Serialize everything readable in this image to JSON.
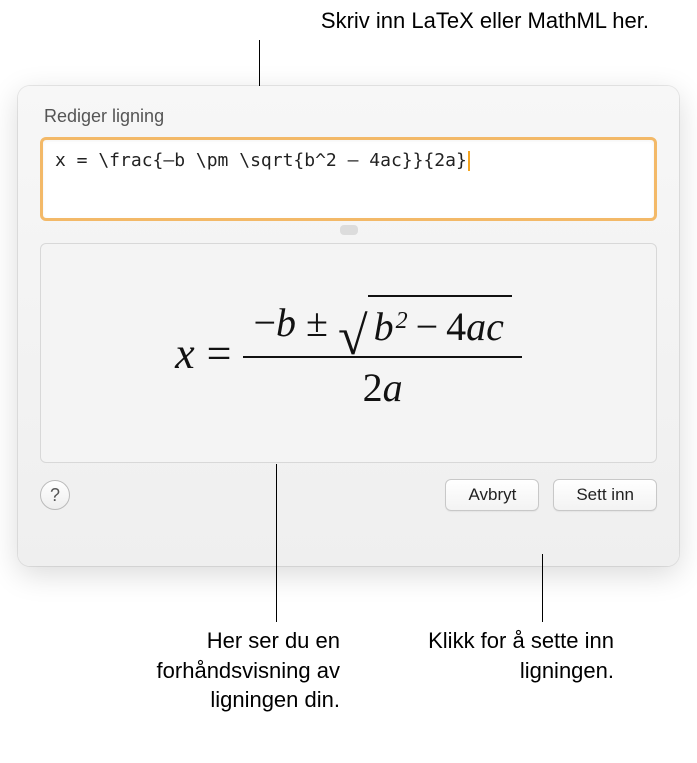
{
  "callouts": {
    "top": "Skriv inn LaTeX eller MathML her.",
    "preview": "Her ser du en forhåndsvisning av ligningen din.",
    "insert": "Klikk for å sette inn ligningen."
  },
  "dialog": {
    "title": "Rediger ligning",
    "input_value": "x = \\frac{–b \\pm \\sqrt{b^2 – 4ac}}{2a}",
    "help_label": "?",
    "cancel_label": "Avbryt",
    "insert_label": "Sett inn"
  },
  "formula": {
    "lhs": "x",
    "eq": "=",
    "neg": "−",
    "b": "b",
    "pm": "±",
    "b2": "b",
    "sup2": "2",
    "minus": "−",
    "four": "4",
    "a": "a",
    "c": "c",
    "denom_2": "2",
    "denom_a": "a"
  }
}
